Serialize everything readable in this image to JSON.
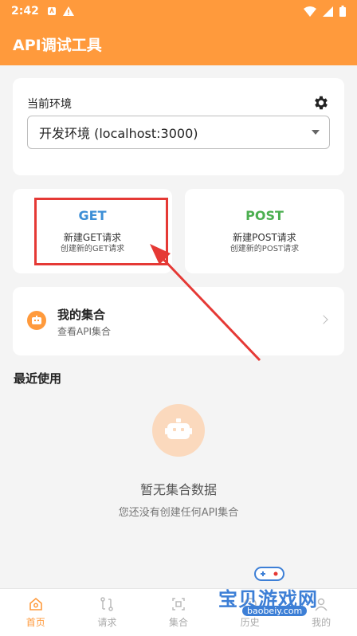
{
  "status_bar": {
    "time": "2:42"
  },
  "app_bar": {
    "title": "API调试工具"
  },
  "environment": {
    "label": "当前环境",
    "selected": "开发环境 (localhost:3000)"
  },
  "methods": {
    "get": {
      "title": "GET",
      "subtitle": "新建GET请求",
      "caption": "创建新的GET请求"
    },
    "post": {
      "title": "POST",
      "subtitle": "新建POST请求",
      "caption": "创建新的POST请求"
    }
  },
  "collections": {
    "title": "我的集合",
    "subtitle": "查看API集合"
  },
  "recent": {
    "title": "最近使用",
    "empty_title": "暂无集合数据",
    "empty_subtitle": "您还没有创建任何API集合"
  },
  "tabs": [
    {
      "label": "首页",
      "icon": "home-icon",
      "active": true
    },
    {
      "label": "请求",
      "icon": "request-icon",
      "active": false
    },
    {
      "label": "集合",
      "icon": "collection-icon",
      "active": false
    },
    {
      "label": "历史",
      "icon": "history-icon",
      "active": false
    },
    {
      "label": "我的",
      "icon": "profile-icon",
      "active": false
    }
  ],
  "watermark": {
    "text": "宝贝游戏网",
    "url": "baobeiy.com"
  },
  "colors": {
    "accent": "#ff9a3c",
    "get": "#3d8fd6",
    "post": "#4caf50",
    "annotation": "#e53935"
  }
}
